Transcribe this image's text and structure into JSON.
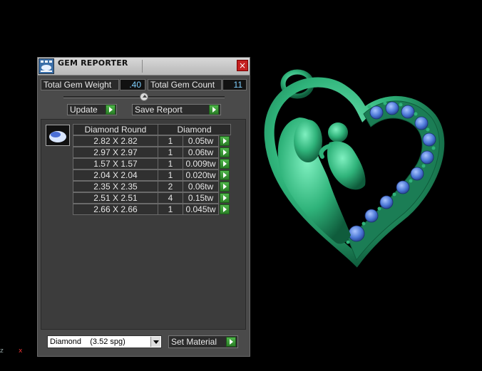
{
  "window": {
    "title": "GEM REPORTER",
    "close_symbol": "×"
  },
  "summary": {
    "weight_label": "Total Gem Weight",
    "weight_value": ".40",
    "count_label": "Total Gem Count",
    "count_value": "11"
  },
  "actions": {
    "update_label": "Update",
    "save_label": "Save Report"
  },
  "table": {
    "headers": [
      "Diamond Round",
      "Diamond"
    ],
    "rows": [
      {
        "size": "2.82 X 2.82",
        "count": "1",
        "weight": "0.05tw"
      },
      {
        "size": "2.97 X 2.97",
        "count": "1",
        "weight": "0.06tw"
      },
      {
        "size": "1.57 X 1.57",
        "count": "1",
        "weight": "0.009tw"
      },
      {
        "size": "2.04 X 2.04",
        "count": "1",
        "weight": "0.020tw"
      },
      {
        "size": "2.35 X 2.35",
        "count": "2",
        "weight": "0.06tw"
      },
      {
        "size": "2.51 X 2.51",
        "count": "4",
        "weight": "0.15tw"
      },
      {
        "size": "2.66 X 2.66",
        "count": "1",
        "weight": "0.045tw"
      }
    ]
  },
  "material": {
    "selected": "Diamond    (3.52 spg)",
    "set_label": "Set Material"
  },
  "axes": {
    "z": "z",
    "x": "x"
  },
  "colors": {
    "pendant": "#2fb37a",
    "gem": "#4b77d6",
    "accent_green": "#3a9a34"
  },
  "icons": {
    "title": "report-icon",
    "close": "close-icon",
    "play": "play-arrow-icon",
    "dropdown": "chevron-down-icon"
  }
}
